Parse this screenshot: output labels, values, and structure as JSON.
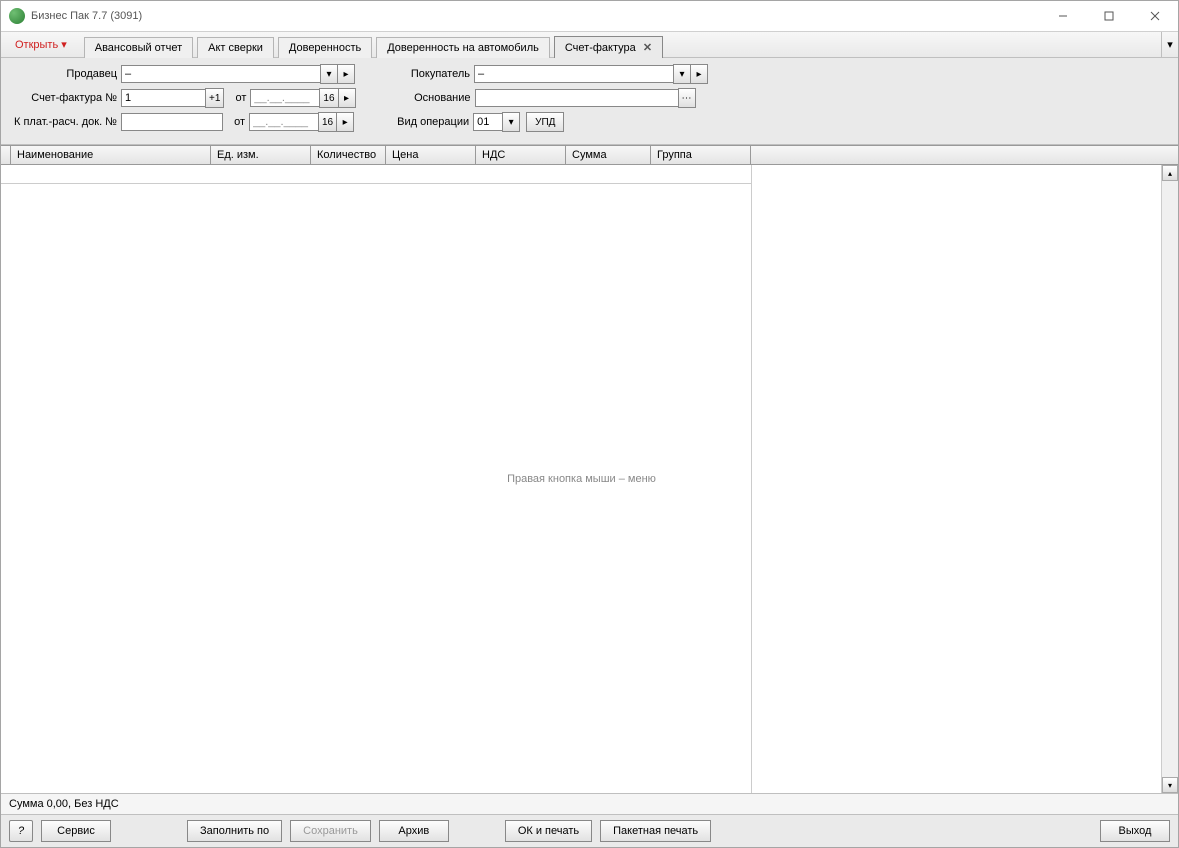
{
  "window": {
    "title": "Бизнес Пак 7.7 (3091)"
  },
  "toolbar": {
    "open": "Открыть"
  },
  "tabs": [
    "Авансовый отчет",
    "Акт сверки",
    "Доверенность",
    "Доверенность на автомобиль",
    "Счет-фактура"
  ],
  "form": {
    "seller_label": "Продавец",
    "seller_value": "–",
    "buyer_label": "Покупатель",
    "buyer_value": "–",
    "invoice_no_label": "Счет-фактура №",
    "invoice_no_value": "1",
    "plus1": "+1",
    "from": "от",
    "date_mask": "__.__.____",
    "date_btn": "16",
    "basis_label": "Основание",
    "basis_value": "",
    "pay_doc_label": "К плат.-расч. док. №",
    "pay_doc_value": "",
    "op_type_label": "Вид операции",
    "op_type_value": "01",
    "upd": "УПД"
  },
  "grid": {
    "headers": [
      "Наименование",
      "Ед. изм.",
      "Количество",
      "Цена",
      "НДС",
      "Сумма",
      "Группа"
    ],
    "hint": "Правая кнопка мыши – меню"
  },
  "status": {
    "text": "Сумма 0,00, Без НДС"
  },
  "footer": {
    "help": "?",
    "service": "Сервис",
    "fill_by": "Заполнить по",
    "save": "Сохранить",
    "archive": "Архив",
    "ok_print": "ОК и печать",
    "batch_print": "Пакетная печать",
    "exit": "Выход"
  }
}
